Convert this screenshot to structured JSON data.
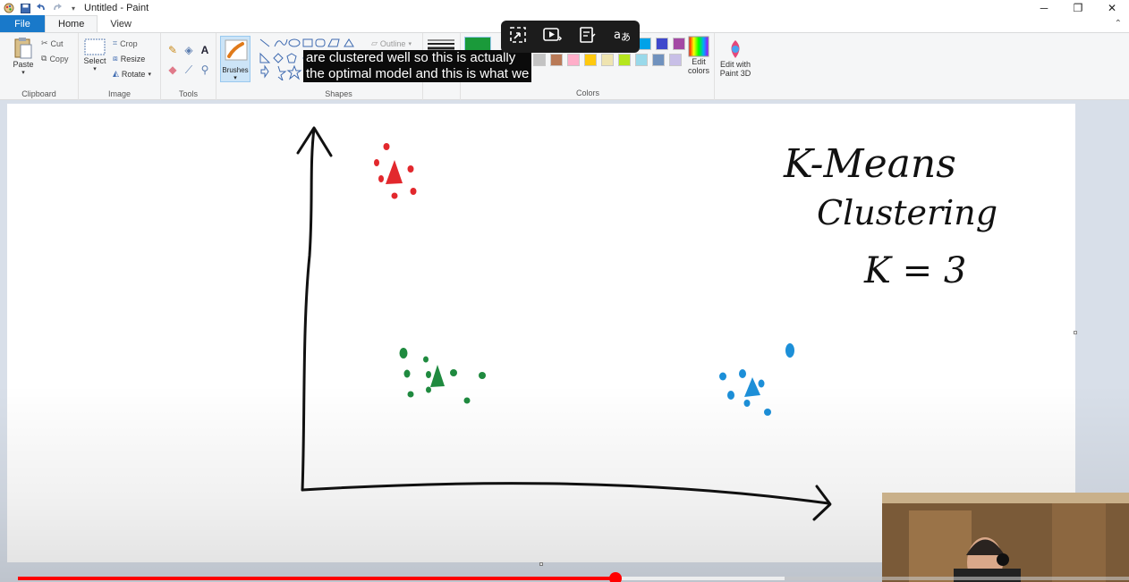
{
  "window": {
    "title": "Untitled - Paint",
    "app_icon": "paint-icon",
    "colors": {
      "file_tab": "#1979ca",
      "ribbon_bg": "#f5f6f7",
      "canvas_bg": "#ffffff",
      "workspace_bg": "#d8dfe9"
    }
  },
  "quick_access": {
    "save_icon": "save-icon",
    "undo_icon": "undo-icon",
    "redo_icon": "redo-icon",
    "customize_icon": "chevron-down-icon"
  },
  "window_controls": {
    "minimize": "─",
    "restore": "❐",
    "close": "✕"
  },
  "tabs": [
    {
      "label": "File"
    },
    {
      "label": "Home"
    },
    {
      "label": "View"
    }
  ],
  "help_glyph": "⌃",
  "ribbon": {
    "clipboard": {
      "label": "Clipboard",
      "paste": "Paste",
      "cut": "Cut",
      "copy": "Copy"
    },
    "image": {
      "label": "Image",
      "select": "Select",
      "crop": "Crop",
      "resize": "Resize",
      "rotate": "Rotate"
    },
    "tools": {
      "label": "Tools"
    },
    "brushes": {
      "label": "Brushes"
    },
    "shapes": {
      "label": "Shapes",
      "outline": "Outline"
    },
    "colors": {
      "label": "Colors",
      "edit_colors_line1": "Edit",
      "edit_colors_line2": "colors",
      "edit_paint3d_line1": "Edit with",
      "edit_paint3d_line2": "Paint 3D",
      "current_color": "#1a9a3a",
      "palette_row1": [
        "#ffffff",
        "#00a2e8",
        "#3f48cc",
        "#a349a4"
      ],
      "palette_row2": [
        "#7f7f7f",
        "#c3c3c3",
        "#b97a57",
        "#ffaec9",
        "#ffc90e",
        "#efe4b0",
        "#b5e61d",
        "#99d9ea",
        "#7092be",
        "#c8bfe7"
      ]
    }
  },
  "caption": {
    "line1": "are clustered well so this is actually",
    "line2": "the optimal model and this is what we"
  },
  "video": {
    "progress_fraction": 0.538,
    "buffered_fraction": 0.69,
    "controls": [
      "exit-fullscreen-icon",
      "autoplay-icon",
      "notes-icon",
      "translate-icon"
    ]
  },
  "drawing": {
    "title_line1": "K-Means",
    "title_line2": "Clustering",
    "k_value": "K = 3",
    "colors": {
      "cluster_red": "#e2282d",
      "cluster_green": "#1f8a3f",
      "cluster_blue": "#1c8fd8",
      "axis": "#111111"
    }
  }
}
